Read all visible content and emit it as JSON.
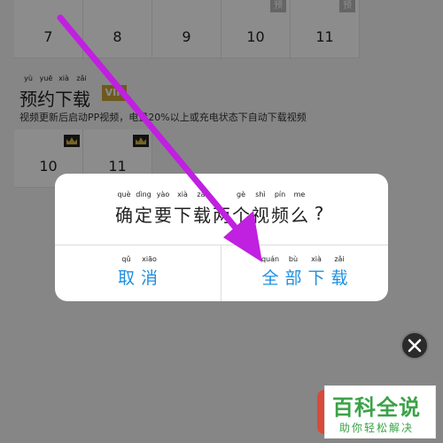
{
  "episodes_row1": [
    {
      "num": "7",
      "tag": ""
    },
    {
      "num": "8",
      "tag": ""
    },
    {
      "num": "9",
      "tag": ""
    },
    {
      "num": "10",
      "tag": "预"
    },
    {
      "num": "11",
      "tag": "预"
    }
  ],
  "episodes_row2": [
    {
      "num": "10",
      "tag": "crown"
    },
    {
      "num": "11",
      "tag": "crown"
    }
  ],
  "section": {
    "title_chars": [
      {
        "ch": "预",
        "py": "yù"
      },
      {
        "ch": "约",
        "py": "yuē"
      },
      {
        "ch": "下",
        "py": "xià"
      },
      {
        "ch": "载",
        "py": "zǎi"
      }
    ],
    "vip_label": "VIP",
    "description": "视频更新后启动PP视频，电量20%以上或充电状态下自动下载视频"
  },
  "dialog": {
    "message_chars": [
      {
        "ch": "确",
        "py": "què"
      },
      {
        "ch": "定",
        "py": "dìng"
      },
      {
        "ch": "要",
        "py": "yào"
      },
      {
        "ch": "下",
        "py": "xià"
      },
      {
        "ch": "载",
        "py": "zǎi"
      },
      {
        "ch": "两",
        "py": ""
      },
      {
        "ch": "个",
        "py": "gè"
      },
      {
        "ch": "视",
        "py": "shì"
      },
      {
        "ch": "频",
        "py": "pín"
      },
      {
        "ch": "么",
        "py": "me"
      },
      {
        "ch": "?",
        "py": ""
      }
    ],
    "cancel_chars": [
      {
        "ch": "取",
        "py": "qǔ"
      },
      {
        "ch": "消",
        "py": "xiāo"
      }
    ],
    "confirm_chars": [
      {
        "ch": "全",
        "py": "quán"
      },
      {
        "ch": "部",
        "py": "bù"
      },
      {
        "ch": "下",
        "py": "xià"
      },
      {
        "ch": "载",
        "py": "zǎi"
      }
    ]
  },
  "close_icon": "close-icon",
  "watermark": {
    "main": "百科全说",
    "sub": "助你轻松解决"
  },
  "colors": {
    "accent": "#1d8fe0",
    "annotation_arrow": "#c020e0",
    "watermark_green": "#3aa347",
    "vip_gold": "#c9a23a"
  }
}
